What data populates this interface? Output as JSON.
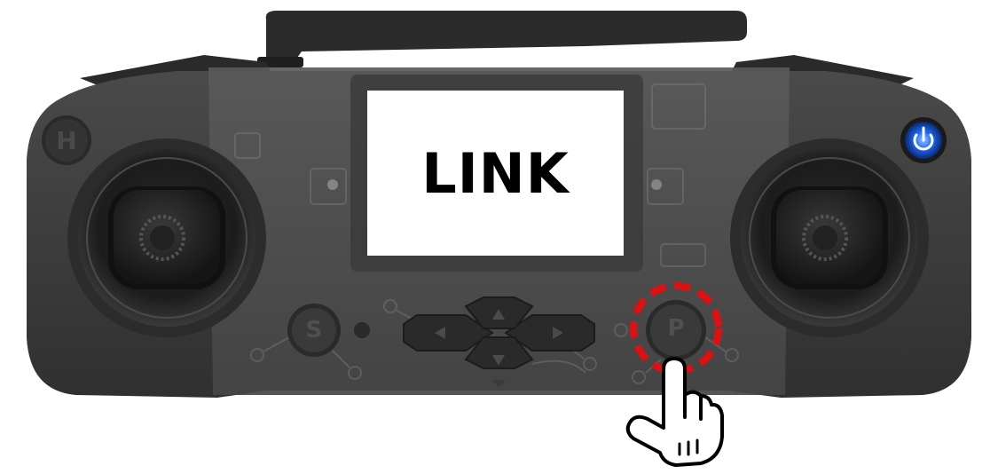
{
  "screen": {
    "text": "LINK"
  },
  "buttons": {
    "home_label": "H",
    "s_label": "S",
    "p_label": "P"
  },
  "icons": {
    "power": "power-icon",
    "hand": "pointing-hand-icon",
    "dpad": "dpad-icon"
  },
  "colors": {
    "body": "#3c3c3c",
    "highlight": "#e01010",
    "power_glow": "#1e6bff",
    "screen": "#ffffff"
  },
  "callout": {
    "target": "P",
    "style": "dashed-red-circle"
  }
}
